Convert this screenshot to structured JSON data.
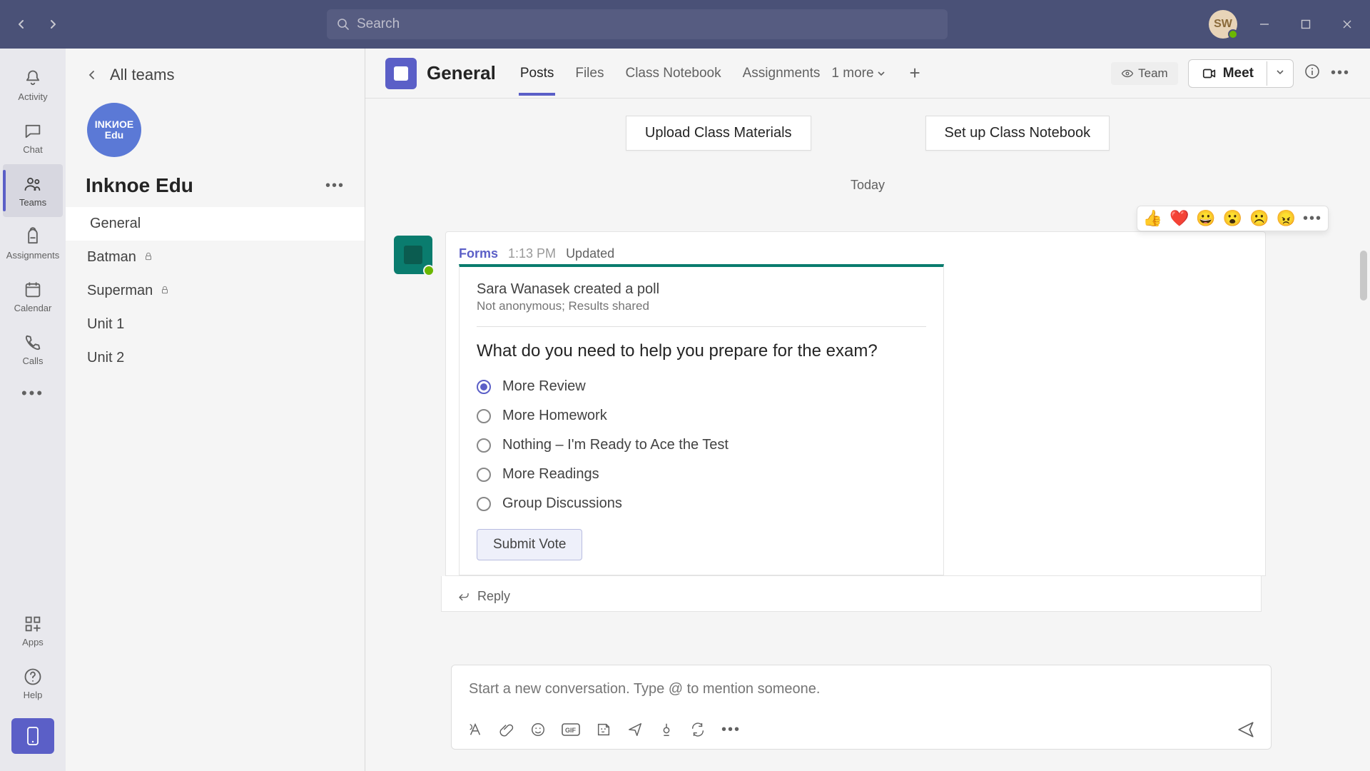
{
  "titlebar": {
    "search_placeholder": "Search",
    "avatar_initials": "SW"
  },
  "rail": {
    "activity": "Activity",
    "chat": "Chat",
    "teams": "Teams",
    "assignments": "Assignments",
    "calendar": "Calendar",
    "calls": "Calls",
    "apps": "Apps",
    "help": "Help"
  },
  "sidebar": {
    "all_teams": "All teams",
    "team_avatar_line1": "INKИOE",
    "team_avatar_line2": "Edu",
    "team_name": "Inknoe Edu",
    "channels": [
      {
        "label": "General",
        "selected": true,
        "private": false
      },
      {
        "label": "Batman",
        "selected": false,
        "private": true
      },
      {
        "label": "Superman",
        "selected": false,
        "private": true
      },
      {
        "label": "Unit 1",
        "selected": false,
        "private": false
      },
      {
        "label": "Unit 2",
        "selected": false,
        "private": false
      }
    ]
  },
  "header": {
    "channel_title": "General",
    "tabs": [
      {
        "label": "Posts",
        "active": true
      },
      {
        "label": "Files",
        "active": false
      },
      {
        "label": "Class Notebook",
        "active": false
      },
      {
        "label": "Assignments",
        "active": false
      }
    ],
    "more_tabs": "1 more",
    "team_pill": "Team",
    "meet": "Meet"
  },
  "actions": {
    "upload": "Upload Class Materials",
    "setup": "Set up Class Notebook"
  },
  "feed": {
    "date": "Today",
    "reactions": [
      "👍",
      "❤️",
      "😀",
      "😮",
      "☹️",
      "😠"
    ],
    "post": {
      "app_name": "Forms",
      "time": "1:13 PM",
      "status": "Updated",
      "creator_line": "Sara Wanasek created a poll",
      "sub_line": "Not anonymous; Results shared",
      "question": "What do you need to help you prepare for the exam?",
      "options": [
        {
          "label": "More Review",
          "selected": true
        },
        {
          "label": "More Homework",
          "selected": false
        },
        {
          "label": "Nothing – I'm Ready to Ace the Test",
          "selected": false
        },
        {
          "label": "More Readings",
          "selected": false
        },
        {
          "label": "Group Discussions",
          "selected": false
        }
      ],
      "submit": "Submit Vote",
      "reply": "Reply"
    }
  },
  "composer": {
    "placeholder": "Start a new conversation. Type @ to mention someone."
  }
}
